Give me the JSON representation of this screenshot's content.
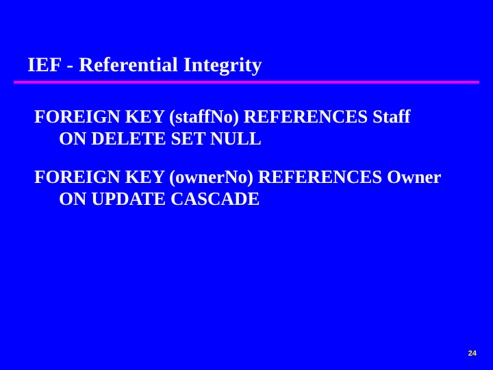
{
  "title": "IEF - Referential Integrity",
  "blocks": [
    {
      "line1": "FOREIGN KEY (staffNo) REFERENCES Staff",
      "line2": "ON DELETE SET NULL"
    },
    {
      "line1": "FOREIGN KEY (ownerNo) REFERENCES Owner",
      "line2": "ON UPDATE CASCADE"
    }
  ],
  "page_number": "24"
}
